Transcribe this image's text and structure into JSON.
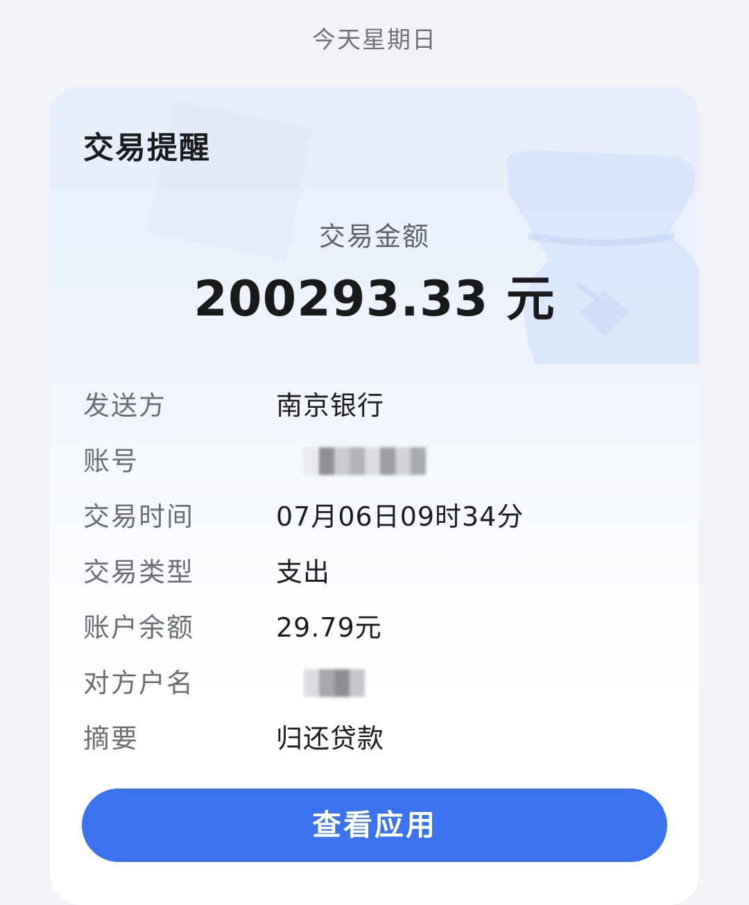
{
  "header": {
    "date_text": "今天星期日"
  },
  "card": {
    "title": "交易提醒",
    "amount_label": "交易金额",
    "amount_value": "200293.33 元",
    "details": [
      {
        "label": "发送方",
        "value": "南京银行"
      },
      {
        "label": "账号",
        "value": ""
      },
      {
        "label": "交易时间",
        "value": "07月06日09时34分"
      },
      {
        "label": "交易类型",
        "value": "支出"
      },
      {
        "label": "账户余额",
        "value": "29.79元"
      },
      {
        "label": "对方户名",
        "value": ""
      },
      {
        "label": "摘要",
        "value": "归还贷款"
      }
    ],
    "button_label": "查看应用"
  },
  "colors": {
    "background": "#f1f3f6",
    "accent": "#3b72f0",
    "card_gradient_top": "#e6eefb"
  },
  "icons": {
    "decor": "money-bag-icon"
  }
}
